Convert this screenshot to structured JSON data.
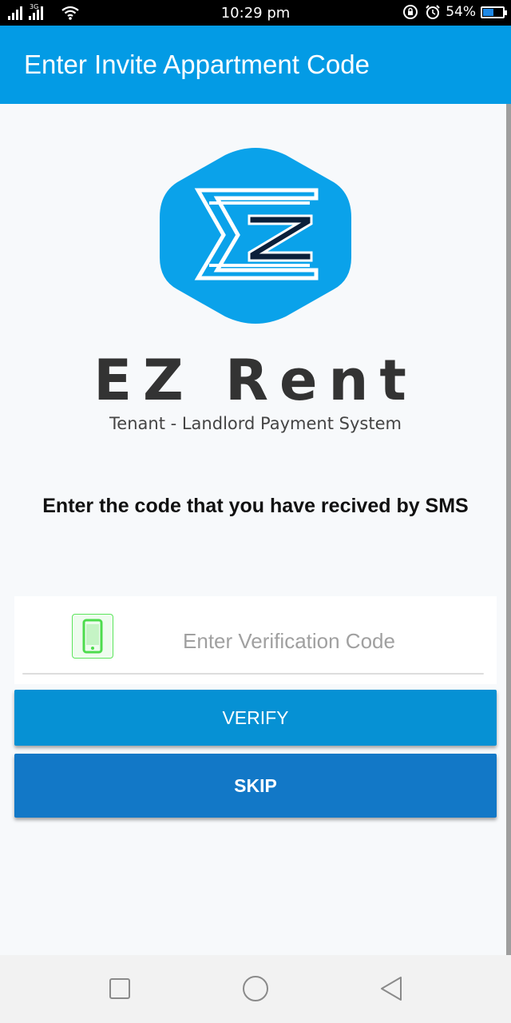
{
  "status_bar": {
    "network_label": "3G",
    "time": "10:29 pm",
    "battery_percent": "54%",
    "battery_level": 0.54,
    "icons": [
      "signal-icon",
      "wifi-icon",
      "lock-icon",
      "alarm-icon",
      "battery-icon"
    ]
  },
  "app_bar": {
    "title": "Enter Invite Appartment Code"
  },
  "brand": {
    "name": "EZ Rent",
    "tagline": "Tenant - Landlord Payment System",
    "logo_color": "#0aa2ea"
  },
  "instruction": "Enter the code that you have recived by SMS",
  "verification": {
    "placeholder": "Enter Verification Code",
    "value": "",
    "icon": "phone-icon"
  },
  "buttons": {
    "verify": "VERIFY",
    "skip": "SKIP"
  },
  "nav_bar": {
    "icons": [
      "recents-icon",
      "home-icon",
      "back-icon"
    ]
  },
  "colors": {
    "app_bar": "#039be5",
    "verify_button": "#0691d4",
    "skip_button": "#1278c7",
    "phone_icon": "#4ddc4d"
  }
}
